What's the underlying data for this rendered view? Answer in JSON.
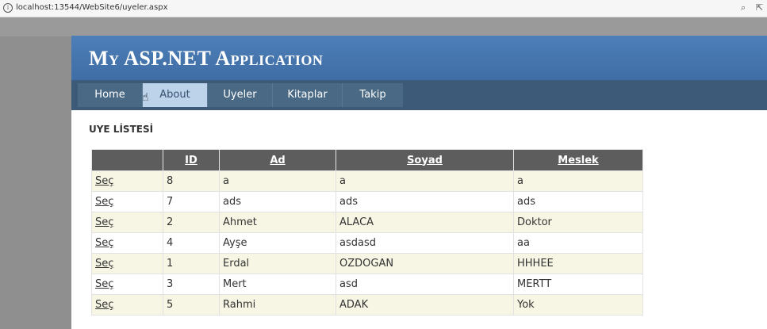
{
  "browser": {
    "url": "localhost:13544/WebSite6/uyeler.aspx"
  },
  "app": {
    "title": "My ASP.NET Application"
  },
  "menu": [
    {
      "label": "Home"
    },
    {
      "label": "About"
    },
    {
      "label": "Uyeler"
    },
    {
      "label": "Kitaplar"
    },
    {
      "label": "Takip"
    }
  ],
  "section_title": "UYE LİSTESİ",
  "table": {
    "headers": [
      "",
      "ID",
      "Ad",
      "Soyad",
      "Meslek"
    ],
    "select_label": "Seç",
    "rows": [
      {
        "id": "8",
        "ad": "a",
        "soyad": "a",
        "meslek": "a"
      },
      {
        "id": "7",
        "ad": "ads",
        "soyad": "ads",
        "meslek": "ads"
      },
      {
        "id": "2",
        "ad": "Ahmet",
        "soyad": "ALACA",
        "meslek": "Doktor"
      },
      {
        "id": "4",
        "ad": "Ayşe",
        "soyad": "asdasd",
        "meslek": "aa"
      },
      {
        "id": "1",
        "ad": "Erdal",
        "soyad": "OZDOGAN",
        "meslek": "HHHEE"
      },
      {
        "id": "3",
        "ad": "Mert",
        "soyad": "asd",
        "meslek": "MERTT"
      },
      {
        "id": "5",
        "ad": "Rahmi",
        "soyad": "ADAK",
        "meslek": "Yok"
      }
    ]
  }
}
